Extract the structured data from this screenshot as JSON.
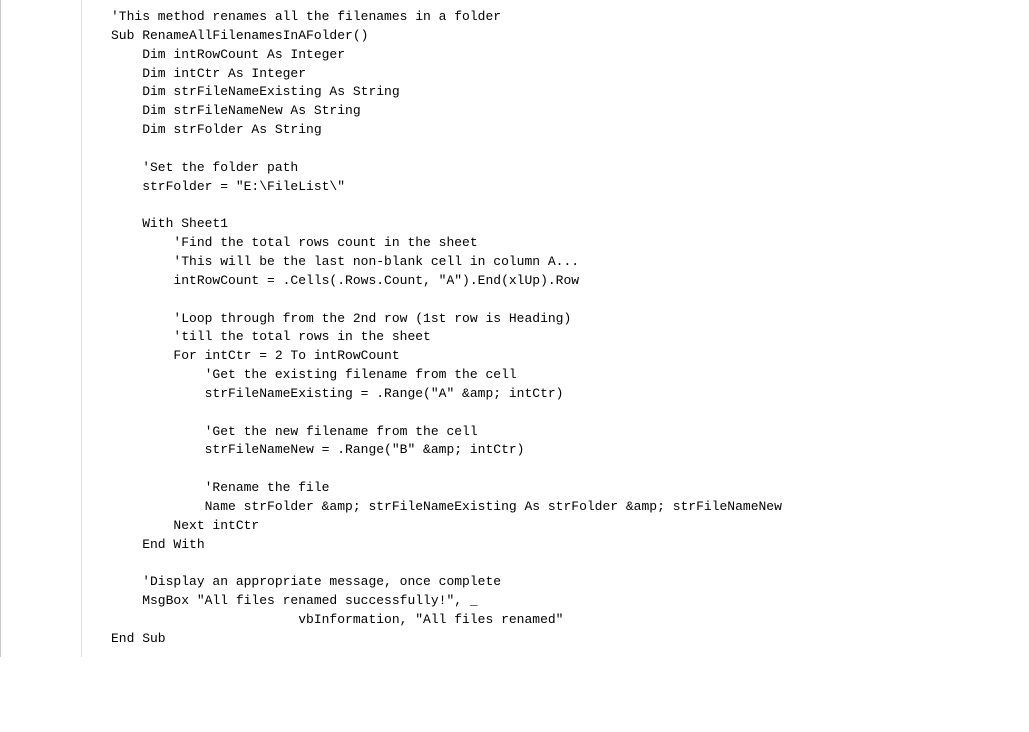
{
  "code": {
    "lines": [
      "'This method renames all the filenames in a folder",
      "Sub RenameAllFilenamesInAFolder()",
      "    Dim intRowCount As Integer",
      "    Dim intCtr As Integer",
      "    Dim strFileNameExisting As String",
      "    Dim strFileNameNew As String",
      "    Dim strFolder As String",
      "",
      "    'Set the folder path",
      "    strFolder = \"E:\\FileList\\\"",
      "",
      "    With Sheet1",
      "        'Find the total rows count in the sheet",
      "        'This will be the last non-blank cell in column A...",
      "        intRowCount = .Cells(.Rows.Count, \"A\").End(xlUp).Row",
      "",
      "        'Loop through from the 2nd row (1st row is Heading)",
      "        'till the total rows in the sheet",
      "        For intCtr = 2 To intRowCount",
      "            'Get the existing filename from the cell",
      "            strFileNameExisting = .Range(\"A\" &amp; intCtr)",
      "",
      "            'Get the new filename from the cell",
      "            strFileNameNew = .Range(\"B\" &amp; intCtr)",
      "",
      "            'Rename the file",
      "            Name strFolder &amp; strFileNameExisting As strFolder &amp; strFileNameNew",
      "        Next intCtr",
      "    End With",
      "",
      "    'Display an appropriate message, once complete",
      "    MsgBox \"All files renamed successfully!\", _",
      "                        vbInformation, \"All files renamed\"",
      "End Sub"
    ]
  }
}
